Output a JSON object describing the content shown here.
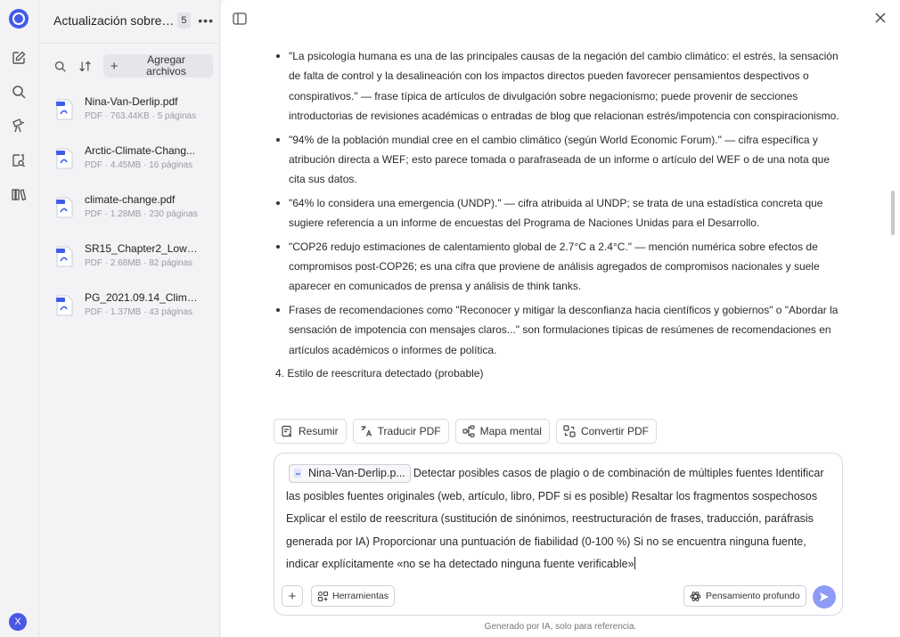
{
  "rail": {
    "items": [
      "logo",
      "edit-icon",
      "search-icon",
      "presentation-icon",
      "document-search-icon",
      "library-icon"
    ],
    "avatar_letter": "X"
  },
  "files": {
    "title": "Actualización sobre ...",
    "count": "5",
    "add_label": "Agregar archivos",
    "items": [
      {
        "name": "Nina-Van-Derlip.pdf",
        "meta": "PDF · 763.44KB · 5 páginas"
      },
      {
        "name": "Arctic-Climate-Chang...",
        "meta": "PDF · 4.45MB · 16 páginas"
      },
      {
        "name": "climate-change.pdf",
        "meta": "PDF · 1.28MB · 230 páginas"
      },
      {
        "name": "SR15_Chapter2_Low_R...",
        "meta": "PDF · 2.68MB · 82 páginas"
      },
      {
        "name": "PG_2021.09.14_Climat...",
        "meta": "PDF · 1.37MB · 43 páginas"
      }
    ]
  },
  "content": {
    "bullets": [
      "\"La psicología humana es una de las principales causas de la negación del cambio climático: el estrés, la sensación de falta de control y la desalineación con los impactos directos pueden favorecer pensamientos despectivos o conspirativos.\" — frase típica de artículos de divulgación sobre negacionismo; puede provenir de secciones introductorias de revisiones académicas o entradas de blog que relacionan estrés/impotencia con conspiracionismo.",
      "\"94% de la población mundial cree en el cambio climático (según World Economic Forum).\" — cifra específica y atribución directa a WEF; esto parece tomada o parafraseada de un informe o artículo del WEF o de una nota que cita sus datos.",
      "\"64% lo considera una emergencia (UNDP).\" — cifra atribuida al UNDP; se trata de una estadística concreta que sugiere referencia a un informe de encuestas del Programa de Naciones Unidas para el Desarrollo.",
      "\"COP26 redujo estimaciones de calentamiento global de 2.7°C a 2.4°C.\" — mención numérica sobre efectos de compromisos post-COP26; es una cifra que proviene de análisis agregados de compromisos nacionales y suele aparecer en comunicados de prensa y análisis de think tanks.",
      "Frases de recomendaciones como \"Reconocer y mitigar la desconfianza hacia científicos y gobiernos\" o \"Abordar la sensación de impotencia con mensajes claros...\" son formulaciones típicas de resúmenes de recomendaciones en artículos académicos o informes de política."
    ],
    "numbered": "4. Estilo de reescritura detectado (probable)"
  },
  "actions": {
    "summarize": "Resumir",
    "translate": "Traducir PDF",
    "mindmap": "Mapa mental",
    "convert": "Convertir PDF"
  },
  "composer": {
    "chip": "Nina-Van-Derlip.p...",
    "text": "Detectar posibles casos de plagio o de combinación de múltiples fuentes Identificar las posibles fuentes originales (web, artículo, libro, PDF si es posible) Resaltar los fragmentos sospechosos Explicar el estilo de reescritura (sustitución de sinónimos, reestructuración de frases, traducción, paráfrasis generada por IA) Proporcionar una puntuación de fiabilidad (0-100 %) Si no se encuentra ninguna fuente, indicar explícitamente «no se ha detectado ninguna fuente verificable»",
    "tools_label": "Herramientas",
    "think_label": "Pensamiento profundo"
  },
  "footer": "Generado por IA, solo para referencia.",
  "colors": {
    "accent": "#4a58e8",
    "send": "#8e9bf6"
  }
}
